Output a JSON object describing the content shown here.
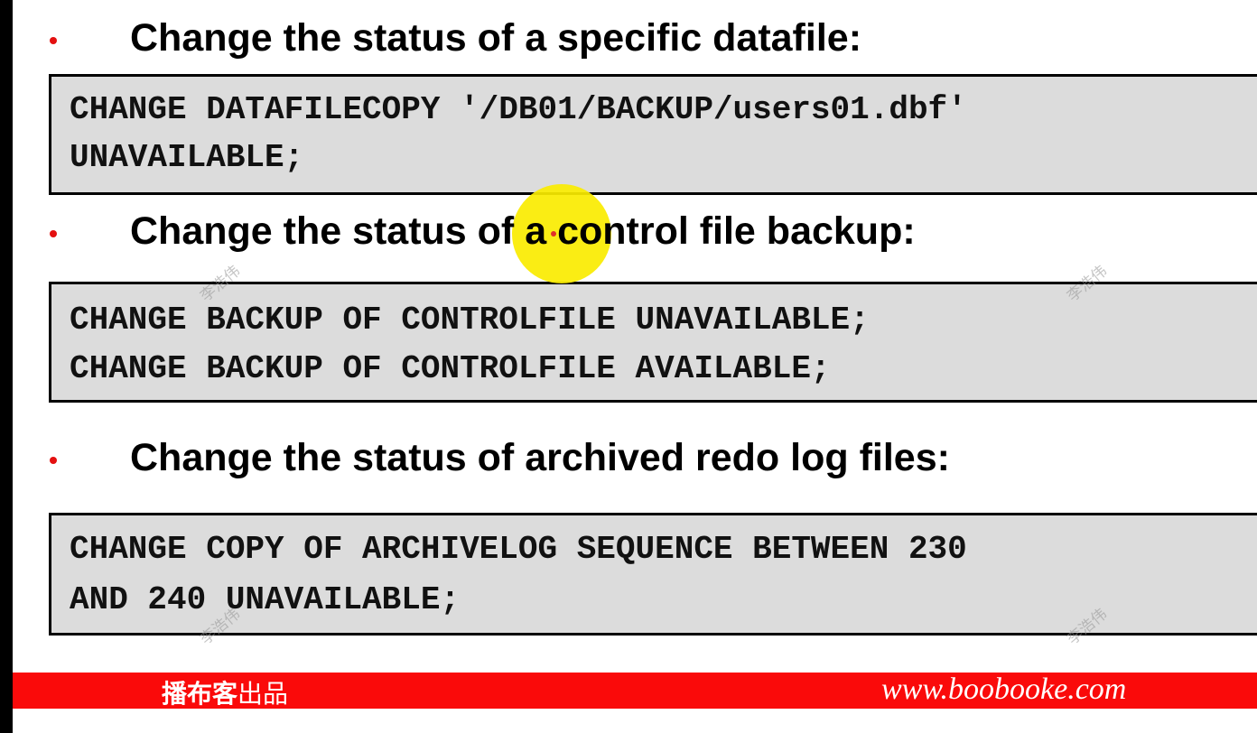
{
  "sections": [
    {
      "heading": "Change the status of a specific datafile:",
      "code": [
        "CHANGE DATAFILECOPY '/DB01/BACKUP/users01.dbf'",
        "UNAVAILABLE;"
      ]
    },
    {
      "heading": "Change the status of a control file backup:",
      "code": [
        "CHANGE BACKUP OF CONTROLFILE UNAVAILABLE;",
        "CHANGE BACKUP OF CONTROLFILE AVAILABLE;"
      ]
    },
    {
      "heading": "Change the status of archived redo log files:",
      "code": [
        "CHANGE COPY OF ARCHIVELOG SEQUENCE BETWEEN 230",
        "AND 240 UNAVAILABLE;"
      ]
    }
  ],
  "footer": {
    "brand_bold": "播布客",
    "brand_rest": "出品",
    "url": "www.boobooke.com"
  },
  "watermark": "李浩伟",
  "colors": {
    "bullet": "#e41010",
    "footer_bar": "#fa0a0a",
    "code_background": "#dcdcdc",
    "cursor_highlight": "#faeb00"
  }
}
